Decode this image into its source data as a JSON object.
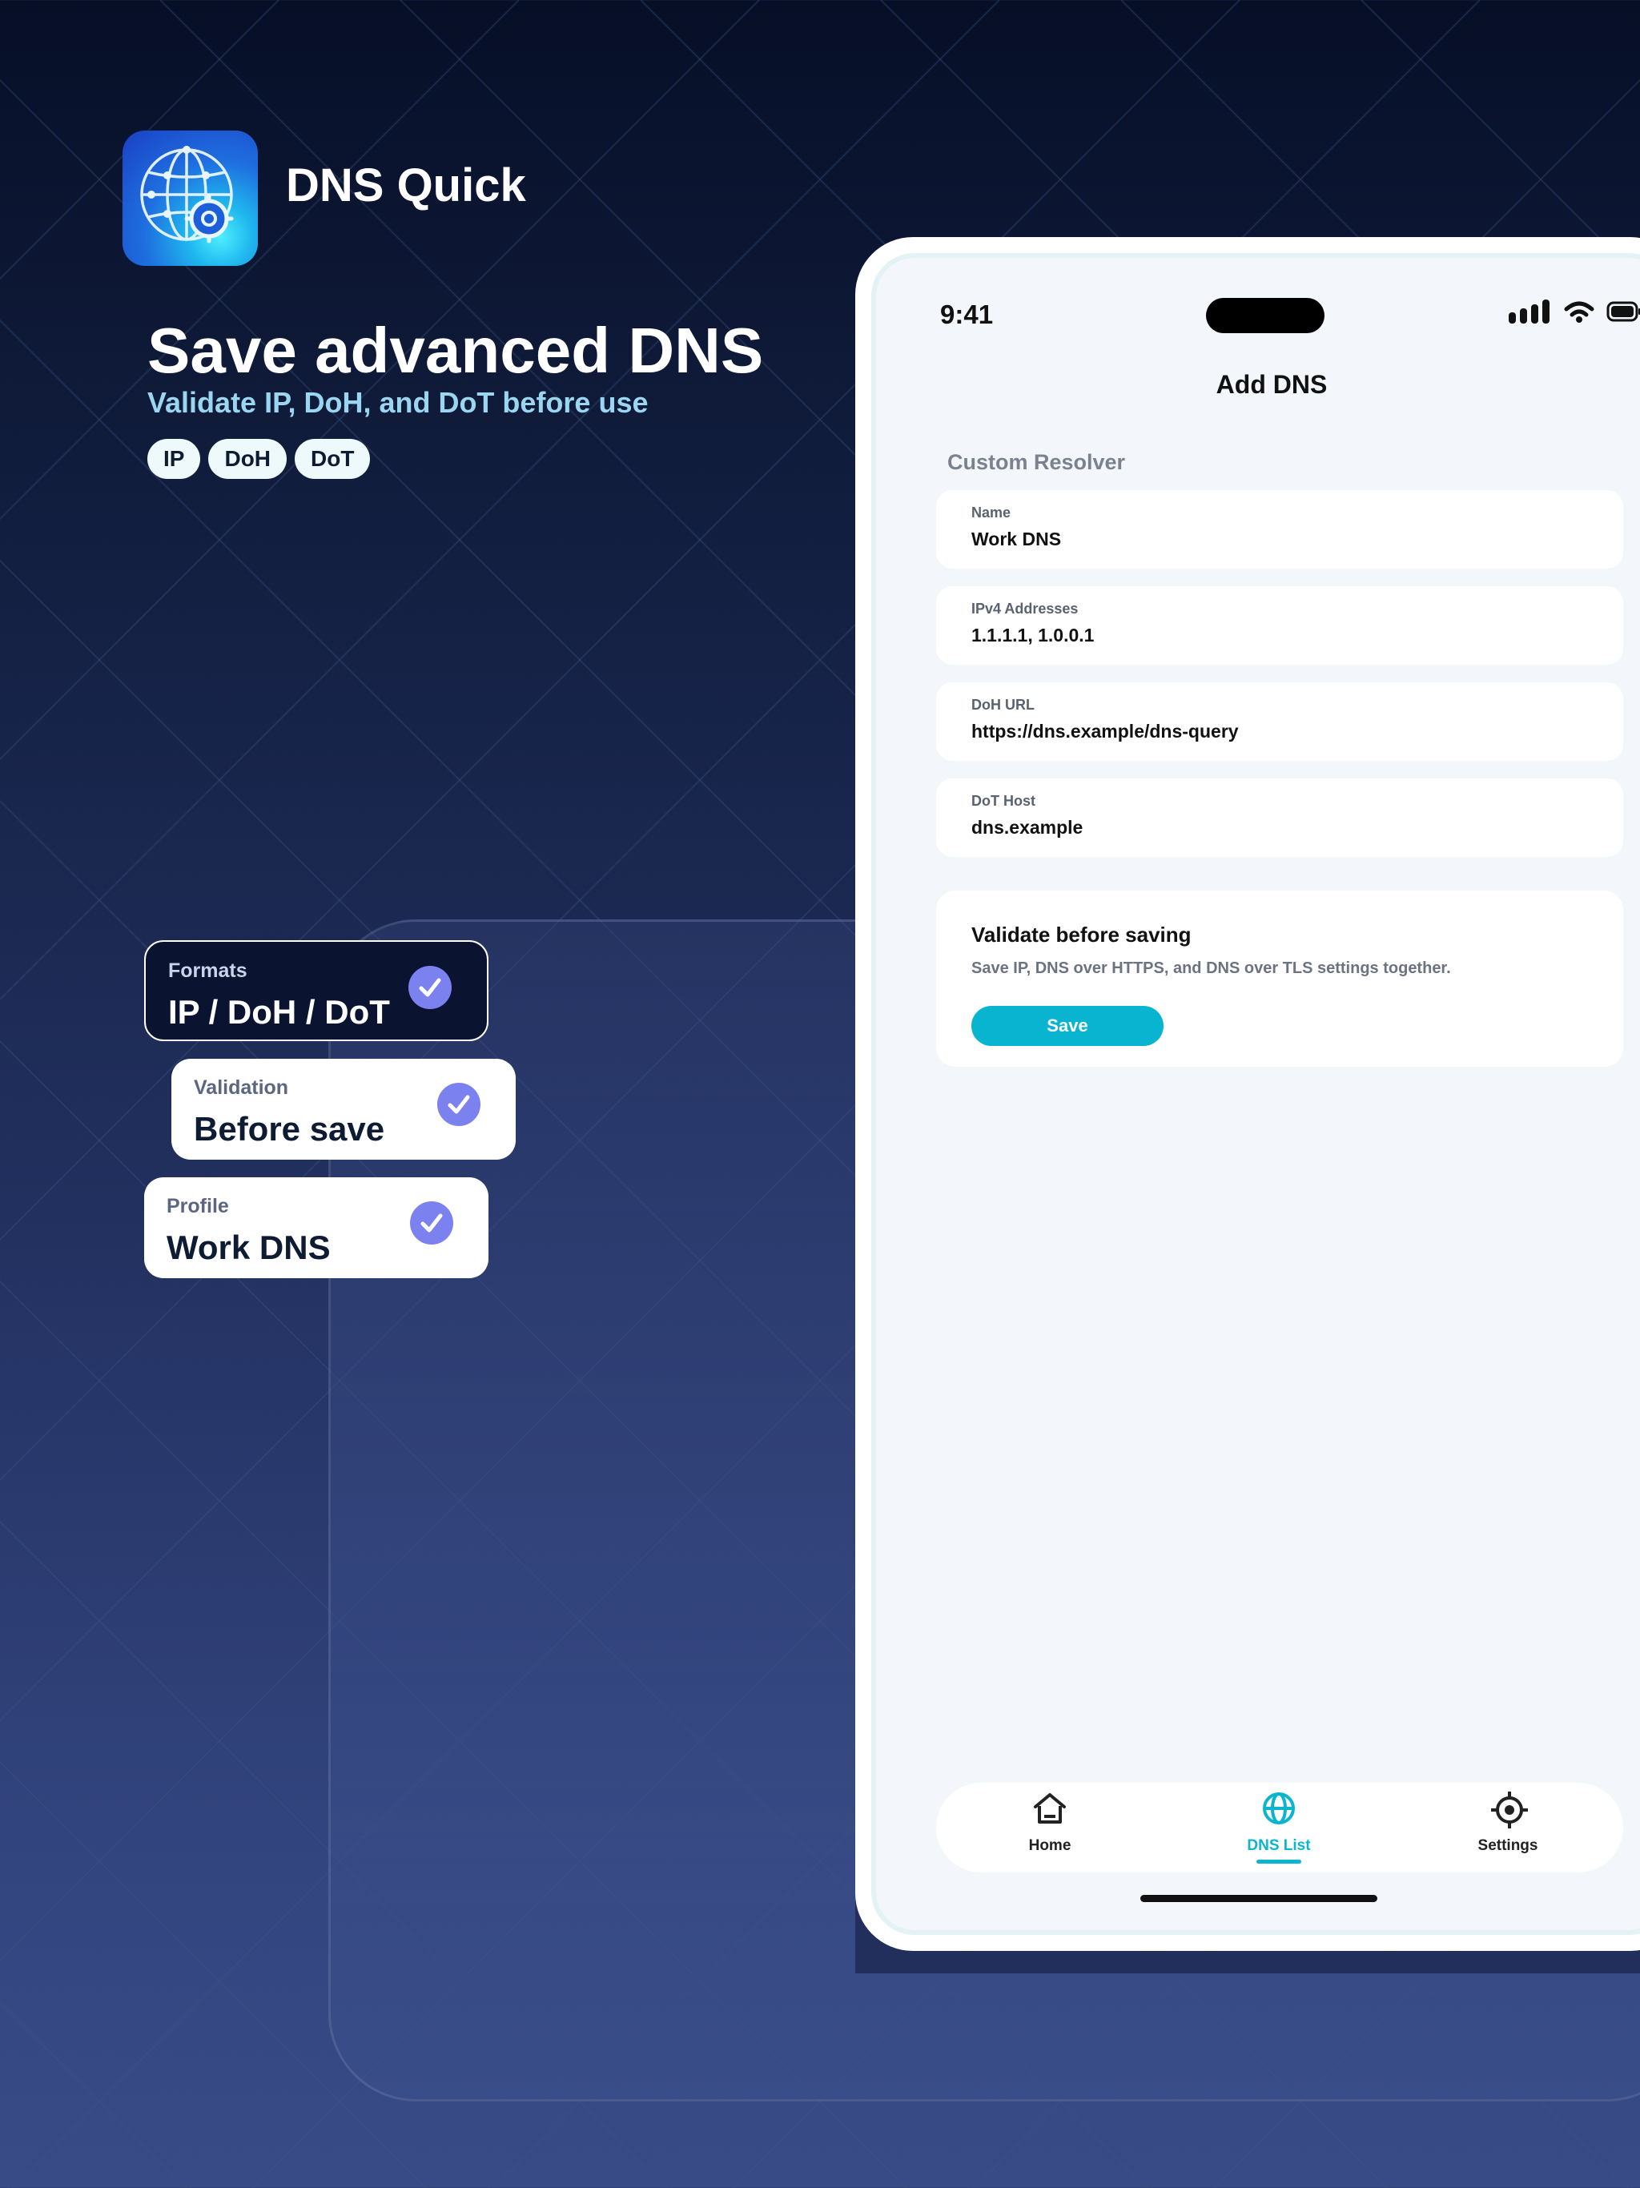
{
  "app": {
    "name": "DNS Quick"
  },
  "promo": {
    "headline": "Save advanced DNS",
    "subheadline": "Validate IP, DoH, and DoT before use",
    "chips": [
      "IP",
      "DoH",
      "DoT"
    ]
  },
  "feature_cards": [
    {
      "label": "Formats",
      "value": "IP / DoH / DoT"
    },
    {
      "label": "Validation",
      "value": "Before save"
    },
    {
      "label": "Profile",
      "value": "Work DNS"
    }
  ],
  "status_bar": {
    "time": "9:41"
  },
  "screen": {
    "title": "Add DNS",
    "section_title": "Custom Resolver",
    "fields": [
      {
        "label": "Name",
        "value": "Work DNS"
      },
      {
        "label": "IPv4 Addresses",
        "value": "1.1.1.1, 1.0.0.1"
      },
      {
        "label": "DoH URL",
        "value": "https://dns.example/dns-query"
      },
      {
        "label": "DoT Host",
        "value": "dns.example"
      }
    ],
    "validate": {
      "title": "Validate before saving",
      "description": "Save IP, DNS over HTTPS, and DNS over TLS settings together.",
      "button_label": "Save"
    }
  },
  "tab_bar": {
    "tabs": [
      {
        "label": "Home",
        "icon": "home-icon"
      },
      {
        "label": "DNS List",
        "icon": "globe-icon",
        "active": true
      },
      {
        "label": "Settings",
        "icon": "crosshair-icon"
      }
    ]
  },
  "colors": {
    "accent": "#08b4cf",
    "check": "#7b82ef",
    "background_top": "#070f27",
    "background_bottom": "#384b87"
  }
}
